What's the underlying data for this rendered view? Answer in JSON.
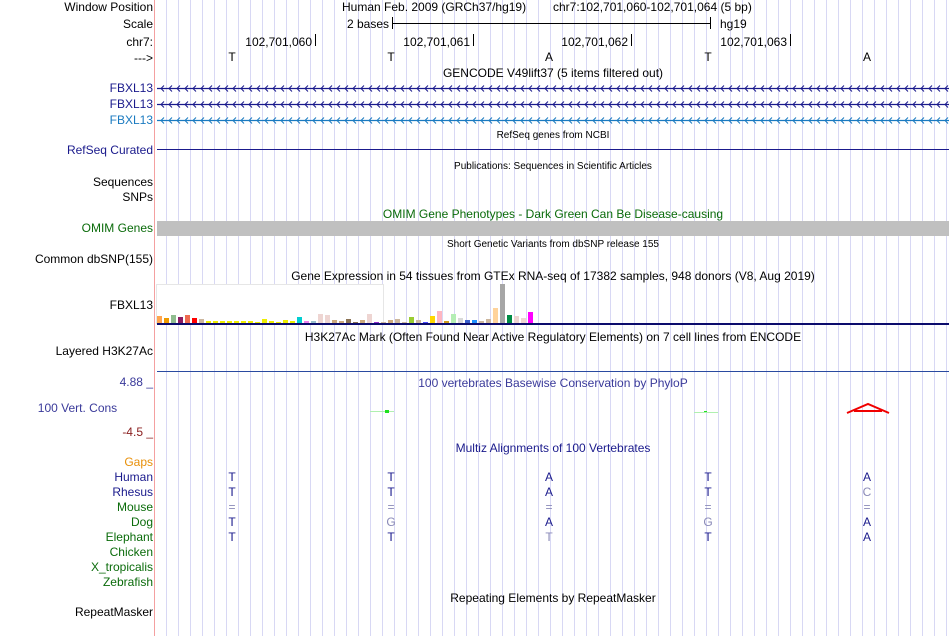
{
  "header": {
    "window_position_label": "Window Position",
    "assembly": "Human Feb. 2009 (GRCh37/hg19)",
    "position": "chr7:102,701,060-102,701,064 (5 bp)",
    "scale_label": "Scale",
    "scale_text": "2 bases",
    "scale_db": "hg19",
    "chrom_label": "chr7:",
    "strand_label": "--->",
    "ruler": [
      "102,701,060",
      "102,701,061",
      "102,701,062",
      "102,701,063"
    ],
    "sequence": [
      "T",
      "T",
      "A",
      "T",
      "A"
    ]
  },
  "tracks": {
    "gencode": {
      "title": "GENCODE V49lift37 (5 items filtered out)",
      "genes": [
        {
          "name": "FBXL13",
          "color": "#1a1a8c"
        },
        {
          "name": "FBXL13",
          "color": "#1a1a8c"
        },
        {
          "name": "FBXL13",
          "color": "#1a7ac0"
        }
      ]
    },
    "refseq": {
      "title": "RefSeq genes from NCBI",
      "label": "RefSeq Curated",
      "color": "#1a1a8c"
    },
    "publications": {
      "title": "Publications: Sequences in Scientific Articles",
      "labels": [
        "Sequences",
        "SNPs"
      ]
    },
    "omim": {
      "title": "OMIM Gene Phenotypes - Dark Green Can Be Disease-causing",
      "label": "OMIM Genes",
      "color": "#0a6b0a"
    },
    "dbsnp": {
      "title": "Short Genetic Variants from dbSNP release 155",
      "label": "Common dbSNP(155)"
    },
    "gtex": {
      "title": "Gene Expression in 54 tissues from GTEx RNA-seq of 17382 samples, 948 donors (V8, Aug 2019)",
      "label": "FBXL13"
    },
    "h3k27ac": {
      "title": "H3K27Ac Mark (Often Found Near Active Regulatory Elements) on 7 cell lines from ENCODE",
      "label": "Layered H3K27Ac"
    },
    "phylop": {
      "title": "100 vertebrates Basewise Conservation by PhyloP",
      "label": "100 Vert. Cons",
      "max": "4.88 _",
      "min": "-4.5 _"
    },
    "multiz": {
      "title": "Multiz Alignments of 100 Vertebrates",
      "gaps_label": "Gaps",
      "species": [
        {
          "name": "Human",
          "bases": [
            "T",
            "T",
            "A",
            "T",
            "A"
          ],
          "dim": [
            0,
            0,
            0,
            0,
            0
          ]
        },
        {
          "name": "Rhesus",
          "bases": [
            "T",
            "T",
            "A",
            "T",
            "C"
          ],
          "dim": [
            0,
            0,
            0,
            0,
            1
          ]
        },
        {
          "name": "Mouse",
          "bases": [
            "=",
            "=",
            "=",
            "=",
            "="
          ],
          "dim": [
            1,
            1,
            1,
            1,
            1
          ]
        },
        {
          "name": "Dog",
          "bases": [
            "T",
            "G",
            "A",
            "G",
            "A"
          ],
          "dim": [
            0,
            1,
            0,
            1,
            0
          ]
        },
        {
          "name": "Elephant",
          "bases": [
            "T",
            "T",
            "T",
            "T",
            "A"
          ],
          "dim": [
            0,
            0,
            1,
            0,
            0
          ]
        },
        {
          "name": "Chicken",
          "bases": [],
          "dim": []
        },
        {
          "name": "X_tropicalis",
          "bases": [],
          "dim": []
        },
        {
          "name": "Zebrafish",
          "bases": [],
          "dim": []
        }
      ]
    },
    "repeatmasker": {
      "title": "Repeating Elements by RepeatMasker",
      "label": "RepeatMasker"
    }
  },
  "chart_data": {
    "type": "bar",
    "title": "Gene Expression in 54 tissues from GTEx RNA-seq of 17382 samples, 948 donors (V8, Aug 2019)",
    "values": [
      7,
      5,
      8,
      6,
      8,
      5,
      4,
      2,
      2,
      2,
      2,
      2,
      2,
      2,
      1,
      4,
      2,
      1,
      3,
      2,
      6,
      2,
      2,
      9,
      8,
      3,
      2,
      4,
      1,
      3,
      9,
      1,
      0.3,
      3,
      4,
      0.3,
      6,
      3,
      1,
      7,
      12,
      2,
      9,
      5,
      3,
      3,
      2,
      4,
      15,
      39,
      8,
      7,
      5,
      11
    ],
    "colors": [
      "#FFA54F",
      "#EE9A00",
      "#8FBC8F",
      "#8B1C62",
      "#EE6A50",
      "#FF0000",
      "#CDB79E",
      "#EEEE00",
      "#EEEE00",
      "#EEEE00",
      "#EEEE00",
      "#EEEE00",
      "#EEEE00",
      "#EEEE00",
      "#EEEE00",
      "#EEEE00",
      "#EEEE00",
      "#EEEE00",
      "#EEEE00",
      "#EEEE00",
      "#00CED1",
      "#EE82EE",
      "#9AC0CD",
      "#EED5D2",
      "#EED5D2",
      "#CDAA7D",
      "#CDAA7D",
      "#8B7355",
      "#8B7355",
      "#CDAA7D",
      "#EED5D2",
      "#9A32CD",
      "#CDB79E",
      "#CDAA7D",
      "#CDB79E",
      "#CDB79E",
      "#9ACD32",
      "#CDB79E",
      "#4D4DFF",
      "#FFD700",
      "#FFB6C1",
      "#CD9B1D",
      "#B4EEB4",
      "#D9D9D9",
      "#3A5FCD",
      "#1E90FF",
      "#CDB79E",
      "#CDB79E",
      "#FFD39B",
      "#A6A6A6",
      "#008B45",
      "#EED5D2",
      "#EED5D2",
      "#FF00FF"
    ]
  }
}
